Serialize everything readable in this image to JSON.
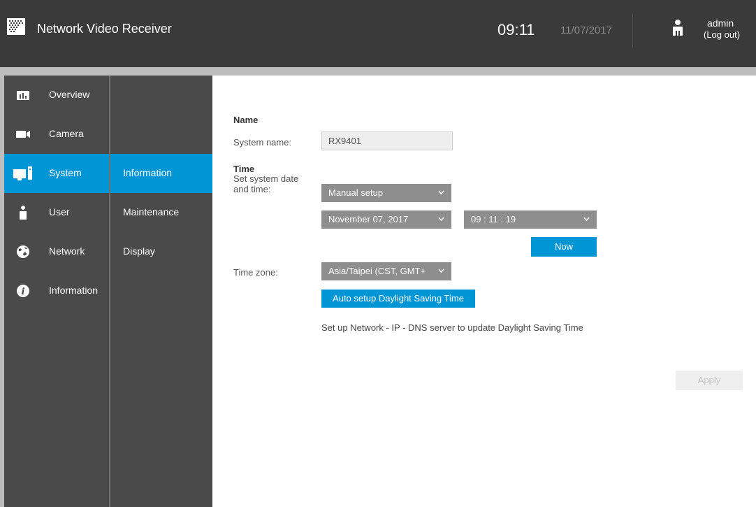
{
  "header": {
    "app_title": "Network Video Receiver",
    "time": "09:11",
    "date": "11/07/2017",
    "user": "admin",
    "logout": "(Log out)"
  },
  "sidebar": {
    "items": [
      {
        "label": "Overview",
        "icon": "bar-chart-icon"
      },
      {
        "label": "Camera",
        "icon": "camera-icon"
      },
      {
        "label": "System",
        "icon": "monitor-icon",
        "active": true
      },
      {
        "label": "User",
        "icon": "user-icon"
      },
      {
        "label": "Network",
        "icon": "globe-icon"
      },
      {
        "label": "Information",
        "icon": "info-icon"
      }
    ],
    "subitems": [
      {
        "label": "Information",
        "active": true
      },
      {
        "label": "Maintenance"
      },
      {
        "label": "Display"
      }
    ]
  },
  "main": {
    "name_section": "Name",
    "system_name_label": "System name:",
    "system_name_value": "RX9401",
    "time_section": "Time",
    "set_datetime_label_1": "Set system date",
    "set_datetime_label_2": "and time:",
    "setup_mode": "Manual setup",
    "date_value": "November 07, 2017",
    "time_value": "09 : 11 : 19",
    "now_button": "Now",
    "timezone_label": "Time zone:",
    "timezone_value": "Asia/Taipei (CST, GMT+",
    "dst_button": "Auto setup Daylight Saving Time",
    "dst_note": "Set up Network - IP - DNS server to update Daylight Saving Time",
    "apply_button": "Apply"
  },
  "colors": {
    "accent": "#0096d6",
    "header_bg": "#3a3a3a",
    "sidebar_bg": "#4a4a4a"
  }
}
